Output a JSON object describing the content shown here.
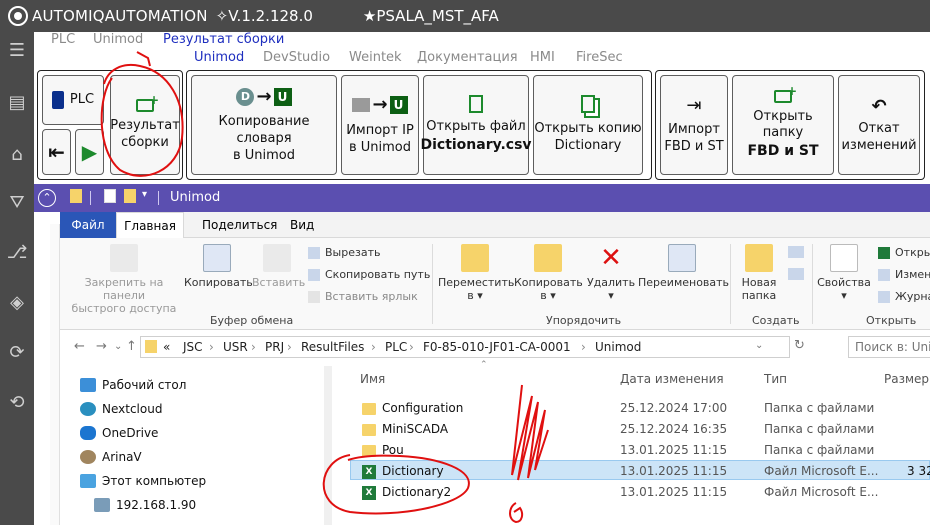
{
  "window": {
    "app_name": "AUTOMIQAUTOMATION",
    "version": "✧V.1.2.128.0",
    "project": "★PSALA_MST_AFA"
  },
  "tabs_top": [
    "PLC",
    "Unimod",
    "Результат сборки"
  ],
  "tabs_second": [
    "Unimod",
    "DevStudio",
    "Weintek",
    "Документация",
    "HMI",
    "FireSec"
  ],
  "ribbon": {
    "plc_label": "PLC",
    "result_label_1": "Результат",
    "result_label_2": "сборки",
    "copy_dict_1": "Копирование словаря",
    "copy_dict_2": "в Unimod",
    "import_ip_1": "Импорт IP",
    "import_ip_2": "в Unimod",
    "open_file_1": "Открыть файл",
    "open_file_2": "Dictionary.csv",
    "open_copy_1": "Открыть копию",
    "open_copy_2": "Dictionary",
    "import_fbd_1": "Импорт",
    "import_fbd_2": "FBD и ST",
    "open_folder_1": "Открыть папку",
    "open_folder_2": "FBD и ST",
    "rollback_1": "Откат",
    "rollback_2": "изменений",
    "d_letter": "D",
    "u_letter": "U"
  },
  "explorer": {
    "title": "Unimod",
    "tabs": [
      "Файл",
      "Главная",
      "Поделиться",
      "Вид"
    ],
    "ribbon": {
      "pin": "Закрепить на панели\nбыстрого доступа",
      "copy": "Копировать",
      "paste": "Вставить",
      "cut": "Вырезать",
      "copy_path": "Скопировать путь",
      "paste_shortcut": "Вставить ярлык",
      "clipboard_group": "Буфер обмена",
      "move": "Переместить\nв ▾",
      "copy_to": "Копировать\nв ▾",
      "delete": "Удалить\n▾",
      "rename": "Переименовать",
      "organize_group": "Упорядочить",
      "new_folder": "Новая\nпапка",
      "create_group": "Создать",
      "properties": "Свойства\n▾",
      "open_group": "Открыть",
      "open_trunc": "Откры",
      "change_trunc": "Измен",
      "log_trunc": "Журна"
    },
    "path": [
      "«",
      "JSC",
      "USR",
      "PRJ",
      "ResultFiles",
      "PLC",
      "F0-85-010-JF01-CA-0001",
      "Unimod"
    ],
    "search_placeholder": "Поиск в: Unin",
    "nav": [
      "Рабочий стол",
      "Nextcloud",
      "OneDrive",
      "ArinaV",
      "Этот компьютер",
      "192.168.1.90"
    ],
    "columns": [
      "Имя",
      "Дата изменения",
      "Тип",
      "Размер"
    ],
    "files": [
      {
        "name": "Configuration",
        "date": "25.12.2024 17:00",
        "type": "Папка с файлами",
        "size": "",
        "kind": "folder"
      },
      {
        "name": "MiniSCADA",
        "date": "25.12.2024 16:35",
        "type": "Папка с файлами",
        "size": "",
        "kind": "folder"
      },
      {
        "name": "Pou",
        "date": "13.01.2025 11:15",
        "type": "Папка с файлами",
        "size": "",
        "kind": "folder"
      },
      {
        "name": "Dictionary",
        "date": "13.01.2025 11:15",
        "type": "Файл Microsoft E...",
        "size": "3 32",
        "kind": "excel"
      },
      {
        "name": "Dictionary2",
        "date": "13.01.2025 11:15",
        "type": "Файл Microsoft E...",
        "size": "",
        "kind": "excel"
      }
    ]
  },
  "colors": {
    "titlebar": "#4a4a4a",
    "accent_tab": "#1f2fbf",
    "explorer_title": "#5b4fb0",
    "file_tab": "#2a56b7",
    "annotation": "#e01010"
  }
}
